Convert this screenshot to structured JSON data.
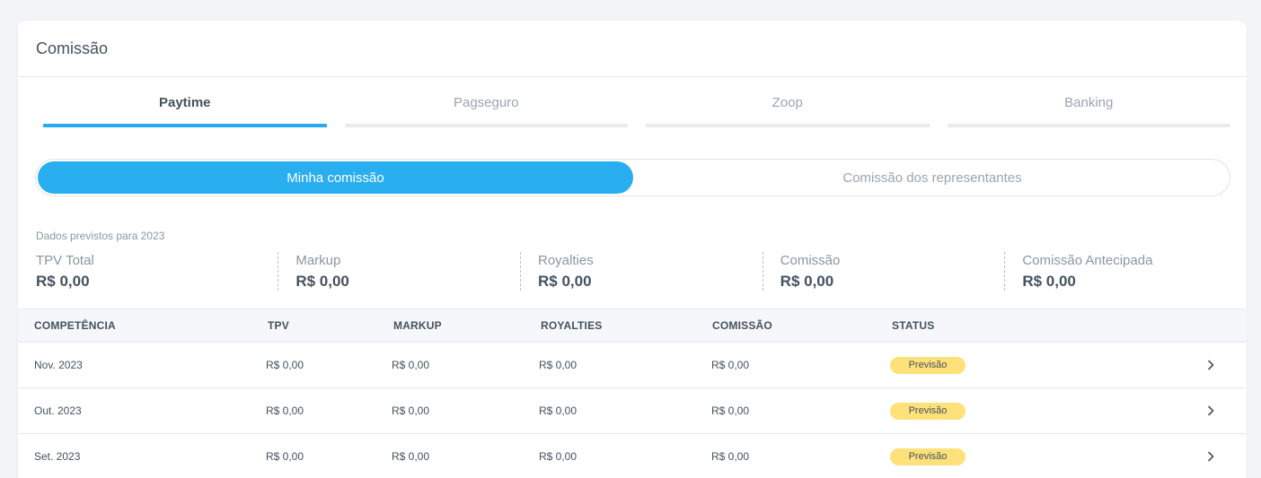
{
  "card": {
    "title": "Comissão"
  },
  "tabs": [
    {
      "label": "Paytime",
      "active": true
    },
    {
      "label": "Pagseguro",
      "active": false
    },
    {
      "label": "Zoop",
      "active": false
    },
    {
      "label": "Banking",
      "active": false
    }
  ],
  "segment": {
    "mine": "Minha comissão",
    "reps": "Comissão dos representantes"
  },
  "summary": {
    "caption": "Dados previstos para 2023",
    "stats": [
      {
        "label": "TPV Total",
        "value": "R$ 0,00"
      },
      {
        "label": "Markup",
        "value": "R$ 0,00"
      },
      {
        "label": "Royalties",
        "value": "R$ 0,00"
      },
      {
        "label": "Comissão",
        "value": "R$ 0,00"
      },
      {
        "label": "Comissão Antecipada",
        "value": "R$ 0,00"
      }
    ]
  },
  "table": {
    "headers": [
      "COMPETÊNCIA",
      "TPV",
      "MARKUP",
      "ROYALTIES",
      "COMISSÃO",
      "STATUS"
    ],
    "rows": [
      {
        "period": "Nov. 2023",
        "tpv": "R$ 0,00",
        "markup": "R$ 0,00",
        "royalties": "R$ 0,00",
        "commission": "R$ 0,00",
        "status": "Previsão"
      },
      {
        "period": "Out. 2023",
        "tpv": "R$ 0,00",
        "markup": "R$ 0,00",
        "royalties": "R$ 0,00",
        "commission": "R$ 0,00",
        "status": "Previsão"
      },
      {
        "period": "Set. 2023",
        "tpv": "R$ 0,00",
        "markup": "R$ 0,00",
        "royalties": "R$ 0,00",
        "commission": "R$ 0,00",
        "status": "Previsão"
      }
    ]
  },
  "colors": {
    "accent": "#29aeef",
    "badge": "#ffe17a"
  },
  "icons": {
    "row_action": "chevron-right-icon"
  }
}
